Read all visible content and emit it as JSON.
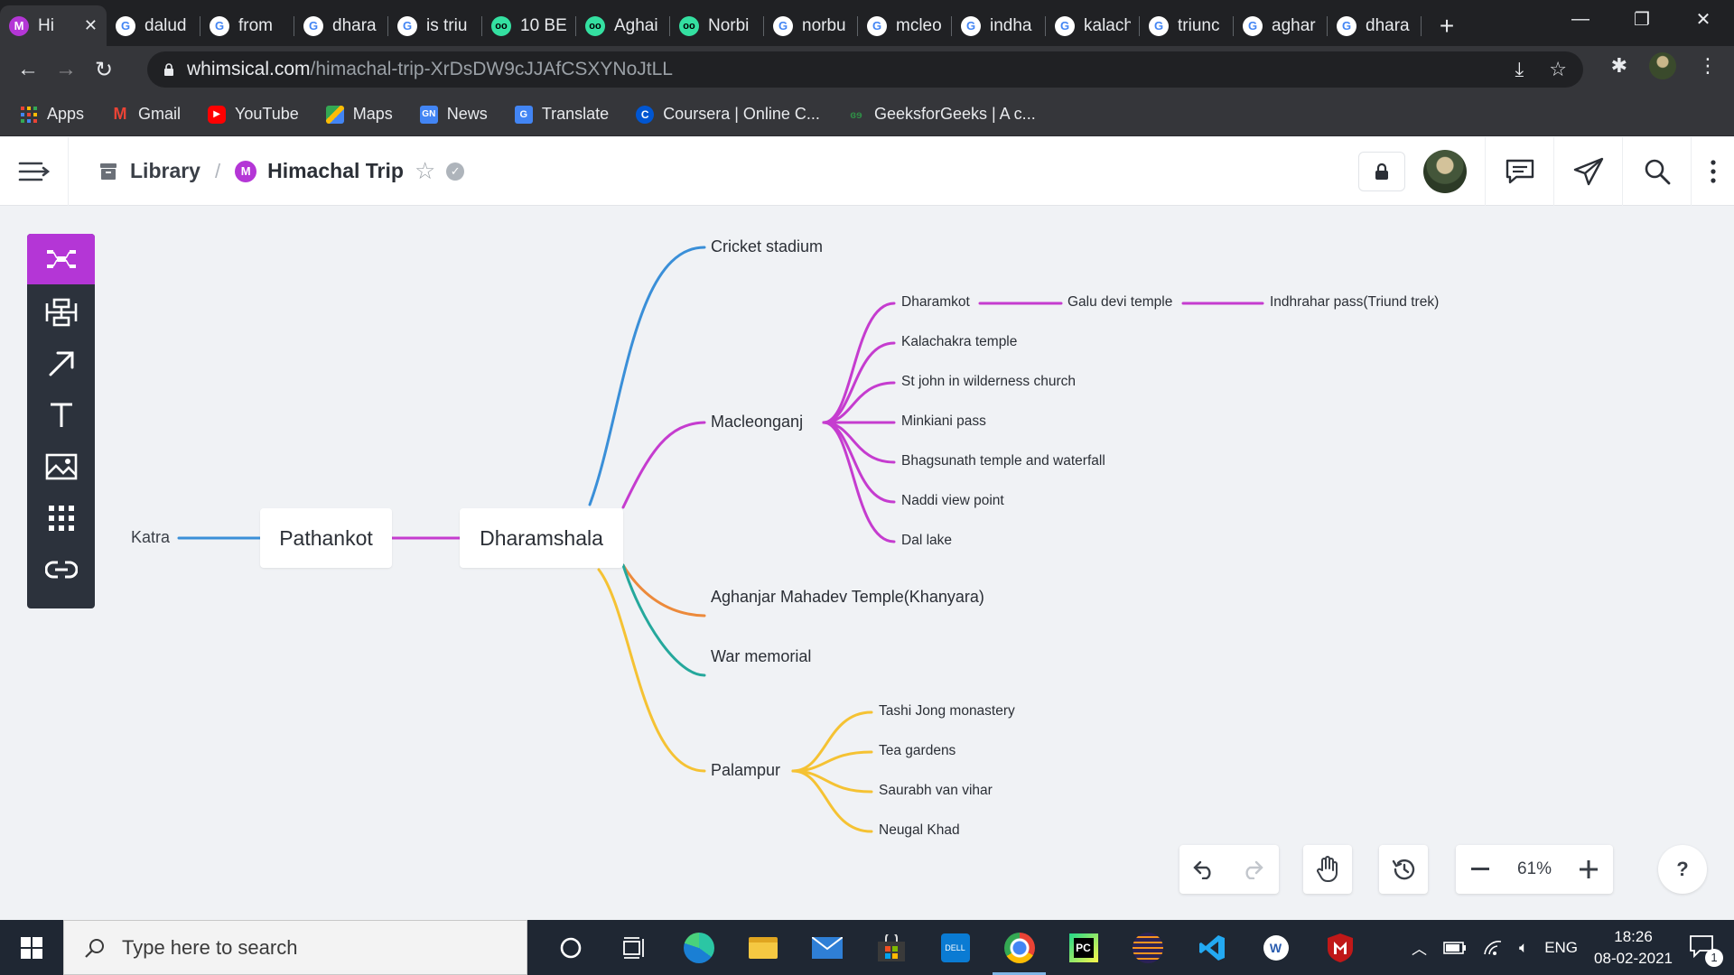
{
  "browser": {
    "tabs": [
      {
        "label": "Hi",
        "icon": "whimsical-favicon"
      },
      {
        "label": "dalud",
        "icon": "google-favicon"
      },
      {
        "label": "from",
        "icon": "google-favicon"
      },
      {
        "label": "dhara",
        "icon": "google-favicon"
      },
      {
        "label": "is triu",
        "icon": "google-favicon"
      },
      {
        "label": "10 BE",
        "icon": "tripadvisor-favicon"
      },
      {
        "label": "Aghai",
        "icon": "tripadvisor-favicon"
      },
      {
        "label": "Norbi",
        "icon": "tripadvisor-favicon"
      },
      {
        "label": "norbu",
        "icon": "google-favicon"
      },
      {
        "label": "mcleo",
        "icon": "google-favicon"
      },
      {
        "label": "indha",
        "icon": "google-favicon"
      },
      {
        "label": "kalach",
        "icon": "google-favicon"
      },
      {
        "label": "triunc",
        "icon": "google-favicon"
      },
      {
        "label": "aghar",
        "icon": "google-favicon"
      },
      {
        "label": "dhara",
        "icon": "google-favicon"
      }
    ],
    "url_host": "whimsical.com",
    "url_path": "/himachal-trip-XrDsDW9cJJAfCSXYNoJtLL",
    "bookmarks": [
      {
        "label": "Apps",
        "icon": "apps-grid-icon"
      },
      {
        "label": "Gmail",
        "icon": "gmail-icon"
      },
      {
        "label": "YouTube",
        "icon": "youtube-icon"
      },
      {
        "label": "Maps",
        "icon": "maps-icon"
      },
      {
        "label": "News",
        "icon": "news-icon"
      },
      {
        "label": "Translate",
        "icon": "translate-icon"
      },
      {
        "label": "Coursera | Online C...",
        "icon": "coursera-icon"
      },
      {
        "label": "GeeksforGeeks | A c...",
        "icon": "geeksforgeeks-icon"
      }
    ]
  },
  "app": {
    "breadcrumb_library": "Library",
    "breadcrumb_separator": "/",
    "doc_badge": "M",
    "doc_title": "Himachal Trip",
    "accent": "#b436d6"
  },
  "mindmap": {
    "root": "Katra",
    "n1": "Pathankot",
    "n2": "Dharamshala",
    "branches": {
      "cricket": "Cricket stadium",
      "macleonganj": "Macleonganj",
      "aghanjar": "Aghanjar Mahadev Temple(Khanyara)",
      "war": "War memorial",
      "palampur": "Palampur"
    },
    "macleonganj_children": {
      "dharamkot": "Dharamkot",
      "galu": "Galu devi temple",
      "indhrahar": "Indhrahar pass(Triund trek)",
      "kalachakra": "Kalachakra temple",
      "stjohn": "St john in wilderness church",
      "minkiani": "Minkiani pass",
      "bhagsunath": "Bhagsunath temple and waterfall",
      "naddi": "Naddi view point",
      "dal": "Dal lake"
    },
    "palampur_children": {
      "tashi": "Tashi Jong monastery",
      "tea": "Tea gardens",
      "saurabh": "Saurabh van vihar",
      "neugal": "Neugal Khad"
    },
    "colors": {
      "blue": "#3a8fd8",
      "purple": "#c53ccf",
      "orange": "#ec8a3b",
      "teal": "#25a89c",
      "yellow": "#f5c233"
    }
  },
  "controls": {
    "zoom": "61%",
    "help": "?"
  },
  "taskbar": {
    "search_placeholder": "Type here to search",
    "language": "ENG",
    "time": "18:26",
    "date": "08-02-2021",
    "notification_count": "1"
  }
}
